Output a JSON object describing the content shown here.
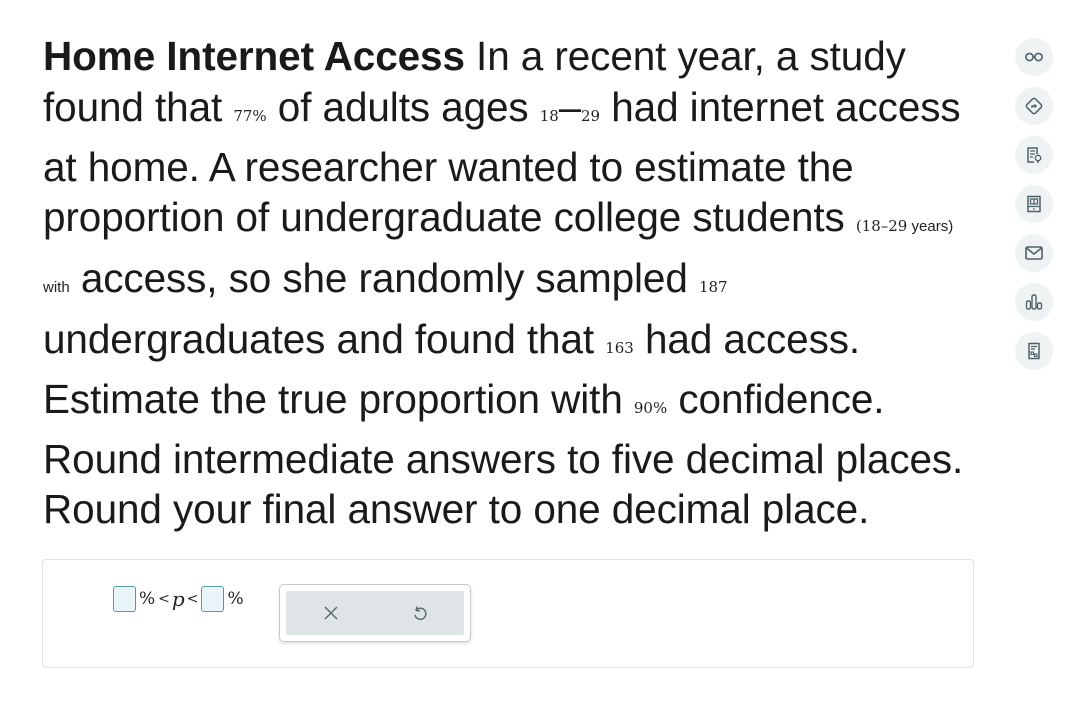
{
  "problem": {
    "title": "Home Internet Access",
    "s1": " In a recent year, a study found that ",
    "pct_adults": "77%",
    "s2": " of adults ages ",
    "age_low": "18",
    "age_dash": "–",
    "age_high": "29",
    "s3": " had internet access at home. A researcher wanted to estimate the proportion of undergraduate college students ",
    "age_note": "(18–29",
    "age_note_tail": " years) with",
    "s4": " access, so she randomly sampled ",
    "sample_size": "187",
    "s5": " undergraduates and found that ",
    "successes": "163",
    "s6": " had access. Estimate the true proportion with ",
    "confidence": "90%",
    "s7": " confidence. Round intermediate answers to five decimal places. Round your final answer to one decimal place."
  },
  "answer": {
    "lower_value": "",
    "upper_value": "",
    "pct1": "%",
    "lt1": "<",
    "var": "p",
    "lt2": "<",
    "pct2": "%"
  },
  "buttons": {
    "clear": "clear",
    "reset": "undo"
  },
  "sidebar": [
    {
      "icon": "glasses-icon",
      "label": "Read aloud"
    },
    {
      "icon": "directions-icon",
      "label": "Go to"
    },
    {
      "icon": "notes-icon",
      "label": "Notes"
    },
    {
      "icon": "textbook-icon",
      "label": "Textbook"
    },
    {
      "icon": "mail-icon",
      "label": "Message"
    },
    {
      "icon": "bar-chart-icon",
      "label": "Data"
    },
    {
      "icon": "calculator-icon",
      "label": "Calculator"
    }
  ],
  "colors": {
    "input_border": "#5a9aa6",
    "input_fill": "#e9f5f8",
    "icon": "#4d6268",
    "icon_bg": "#f0f3f4"
  }
}
